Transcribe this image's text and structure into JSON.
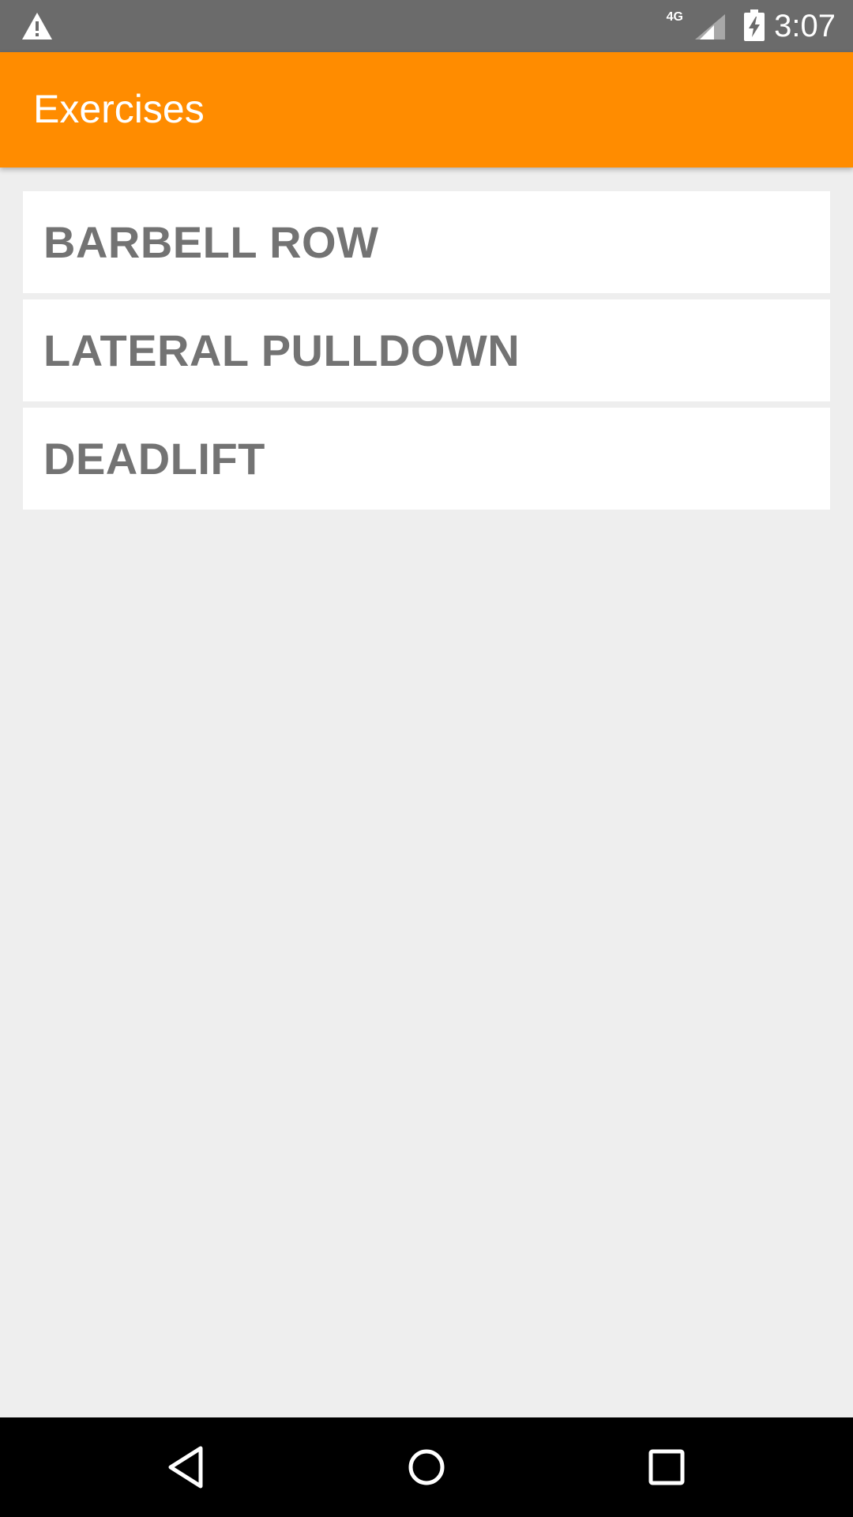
{
  "status_bar": {
    "network_type": "4G",
    "time": "3:07",
    "icons": [
      "warning-icon",
      "signal-icon",
      "battery-charging-icon"
    ]
  },
  "app_bar": {
    "title": "Exercises",
    "color": "#ff8c00"
  },
  "exercises": [
    {
      "label": "BARBELL ROW"
    },
    {
      "label": "LATERAL PULLDOWN"
    },
    {
      "label": "DEADLIFT"
    }
  ],
  "nav_bar": {
    "icons": [
      "back-icon",
      "home-icon",
      "recents-icon"
    ]
  }
}
